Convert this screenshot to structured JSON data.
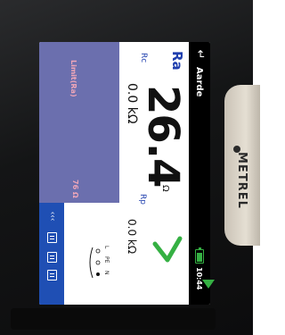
{
  "device": {
    "brand": "METREL"
  },
  "screen": {
    "title": "Aarde",
    "clock": "10:44",
    "battery_icon": "battery-full-icon",
    "back_icon": "back-arrow-icon",
    "result": {
      "main_label": "Ra",
      "main_value": "26.4",
      "main_unit": "Ω",
      "rc_label": "Rc",
      "rc_value": "0.0 kΩ",
      "rp_label": "Rp",
      "rp_value": "0.0 kΩ",
      "status_icon": "check-icon",
      "status_color": "#35b043"
    },
    "limit": {
      "label": "Limit(Ra)",
      "value": "76 Ω"
    },
    "terminals": {
      "labels": [
        "L",
        "PE",
        "N"
      ]
    },
    "function_bar": {
      "keys": [
        {
          "icon": "options-icon",
          "label": "‹‹‹"
        },
        {
          "icon": "document-icon"
        },
        {
          "icon": "list-icon"
        },
        {
          "icon": "memory-icon"
        },
        {
          "icon": "start-test-icon"
        }
      ],
      "accent": "#1f4fb4"
    }
  }
}
